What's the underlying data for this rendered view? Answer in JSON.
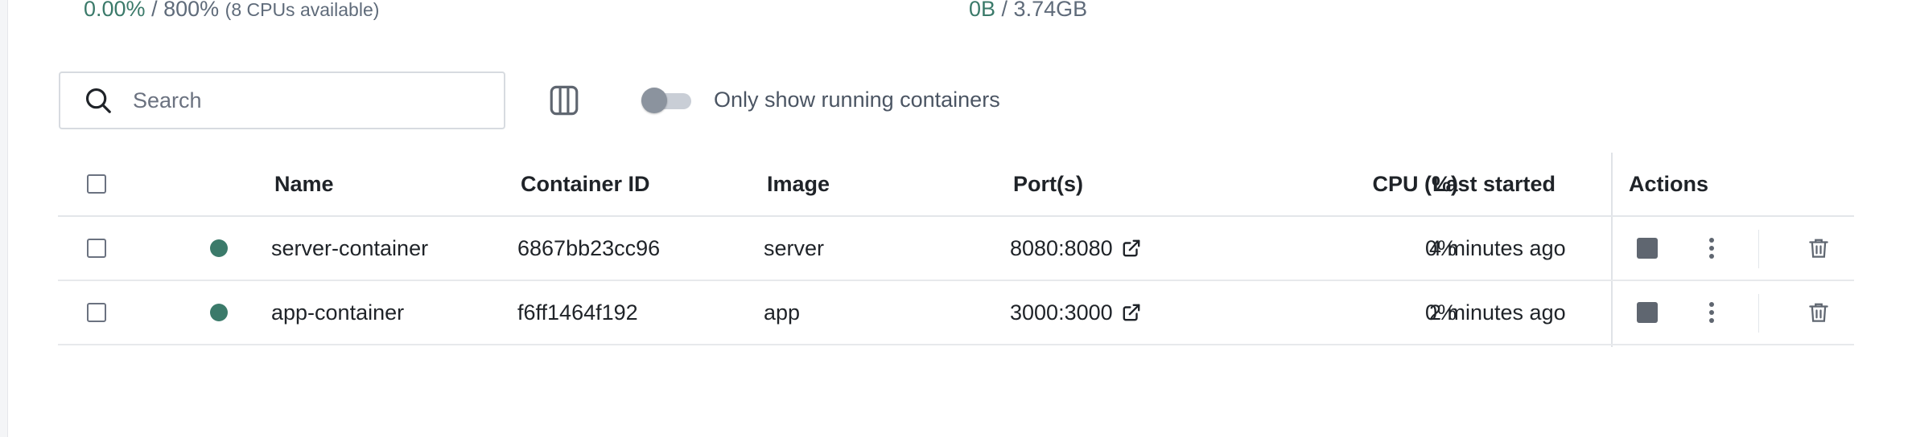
{
  "stats": {
    "cpu": {
      "value": "0.00%",
      "sep": " / ",
      "max": "800%",
      "note": "(8 CPUs available)"
    },
    "memory": {
      "value": "0B",
      "sep": " / ",
      "max": "3.74GB"
    }
  },
  "toolbar": {
    "search_placeholder": "Search",
    "search_value": "",
    "only_running_label": "Only show running containers",
    "only_running_enabled": false
  },
  "table": {
    "headers": {
      "name": "Name",
      "container_id": "Container ID",
      "image": "Image",
      "ports": "Port(s)",
      "cpu": "CPU (%)",
      "last_started": "Last started",
      "actions": "Actions"
    },
    "rows": [
      {
        "name": "server-container",
        "container_id": "6867bb23cc96",
        "image": "server",
        "ports": "8080:8080",
        "cpu": "0%",
        "last_started": "4 minutes ago",
        "status": "running"
      },
      {
        "name": "app-container",
        "container_id": "f6ff1464f192",
        "image": "app",
        "ports": "3000:3000",
        "cpu": "0%",
        "last_started": "2 minutes ago",
        "status": "running"
      }
    ]
  },
  "icons": {
    "search": "search-icon",
    "columns": "columns-icon",
    "external_link": "external-link-icon",
    "stop": "stop-icon",
    "more": "more-vertical-icon",
    "delete": "trash-icon"
  },
  "colors": {
    "running_dot": "#3b7a6a",
    "stat_value": "#3b7a6a",
    "stop_button": "#5f6670"
  }
}
